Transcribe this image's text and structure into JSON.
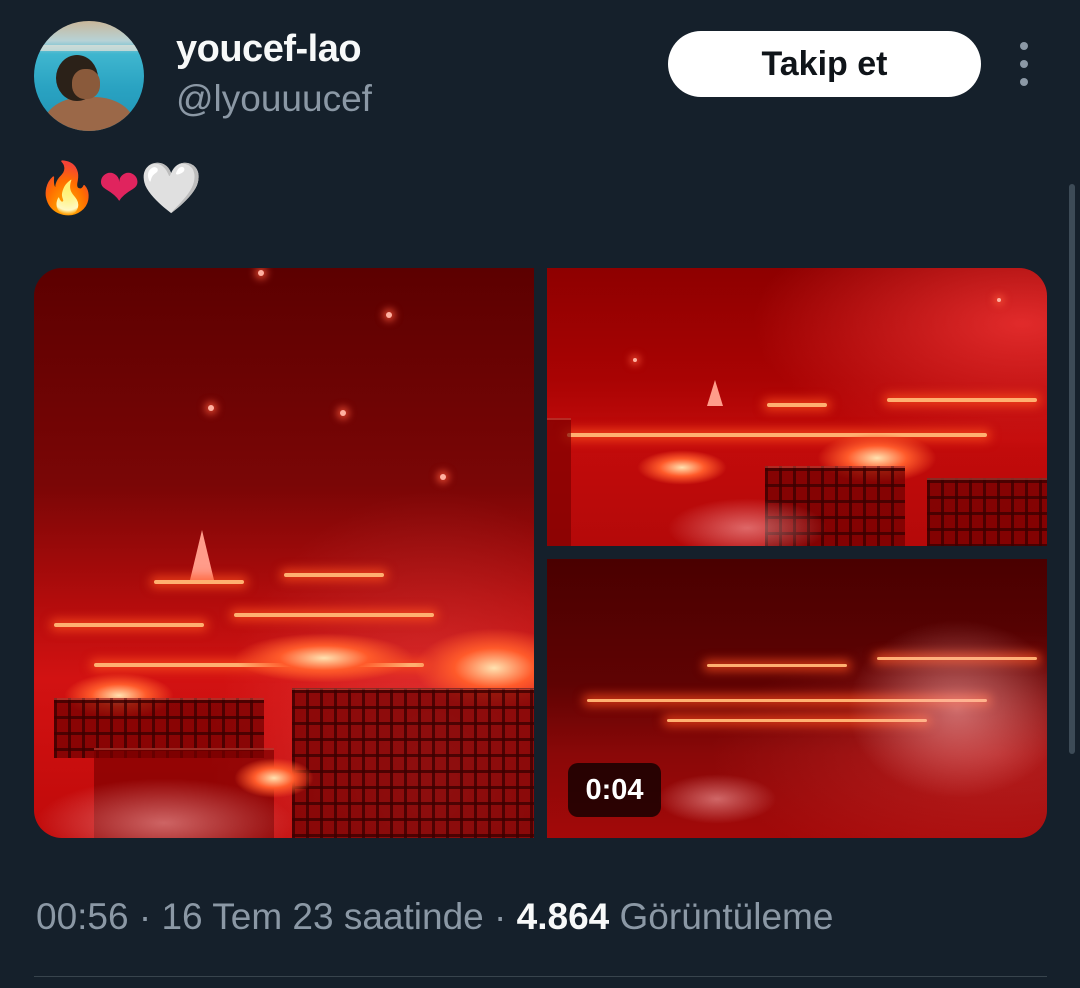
{
  "author": {
    "display_name": "youcef-lao",
    "handle": "@lyouuucef",
    "avatar_icon": "profile-photo"
  },
  "actions": {
    "follow_label": "Takip et",
    "more_icon": "more-vertical-icon"
  },
  "tweet": {
    "emojis": [
      "🔥",
      "❤",
      "🤍"
    ]
  },
  "media": {
    "video_duration": "0:04"
  },
  "meta": {
    "time": "00:56",
    "separator": " · ",
    "date": "16 Tem 23 saatinde",
    "views_count": "4.864",
    "views_label": "Görüntüleme"
  },
  "colors": {
    "background": "#15202b",
    "text_primary": "#f7f9f9",
    "text_secondary": "#8b98a5",
    "follow_button_bg": "#ffffff"
  }
}
